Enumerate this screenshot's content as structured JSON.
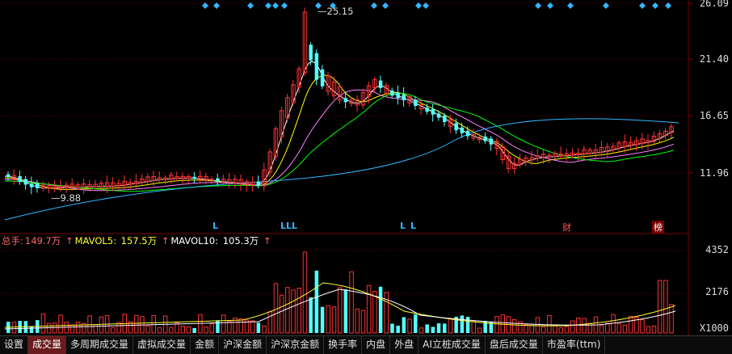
{
  "price_axis": {
    "labels": [
      "26.09",
      "21.40",
      "16.65",
      "11.96"
    ]
  },
  "volume_axis": {
    "labels": [
      "4352",
      "2176",
      "X1000"
    ]
  },
  "annotations": {
    "high": "25.15",
    "low": "9.88"
  },
  "flags": {
    "L": "L",
    "LLL": "LLL",
    "cai": "财",
    "bang": "榜"
  },
  "indicator": {
    "total_label": "总手:",
    "total_value": "149.7万",
    "mavol5_label": "MAVOL5:",
    "mavol5_value": "157.5万",
    "mavol10_label": "MAVOL10:",
    "mavol10_value": "105.3万",
    "up_arrow": "↑"
  },
  "tabs": [
    {
      "label": "设置",
      "active": false
    },
    {
      "label": "成交量",
      "active": true
    },
    {
      "label": "多周期成交量",
      "active": false
    },
    {
      "label": "虚拟成交量",
      "active": false
    },
    {
      "label": "金额",
      "active": false
    },
    {
      "label": "沪深金额",
      "active": false
    },
    {
      "label": "沪深京金额",
      "active": false
    },
    {
      "label": "换手率",
      "active": false
    },
    {
      "label": "内盘",
      "active": false
    },
    {
      "label": "外盘",
      "active": false
    },
    {
      "label": "AI立桩成交量",
      "active": false
    },
    {
      "label": "盘后成交量",
      "active": false
    },
    {
      "label": "市盈率(ttm)",
      "active": false
    }
  ],
  "colors": {
    "up": "#ff3232",
    "down": "#54ffff",
    "ma5": "#ffffff",
    "ma10": "#ffff00",
    "ma20": "#ff80ff",
    "ma30": "#00ff00",
    "ma60": "#33b6ff",
    "grid": "#7a0000",
    "total": "#ff6a6a",
    "mavol5": "#ffff33",
    "mavol10": "#ffffff"
  }
}
